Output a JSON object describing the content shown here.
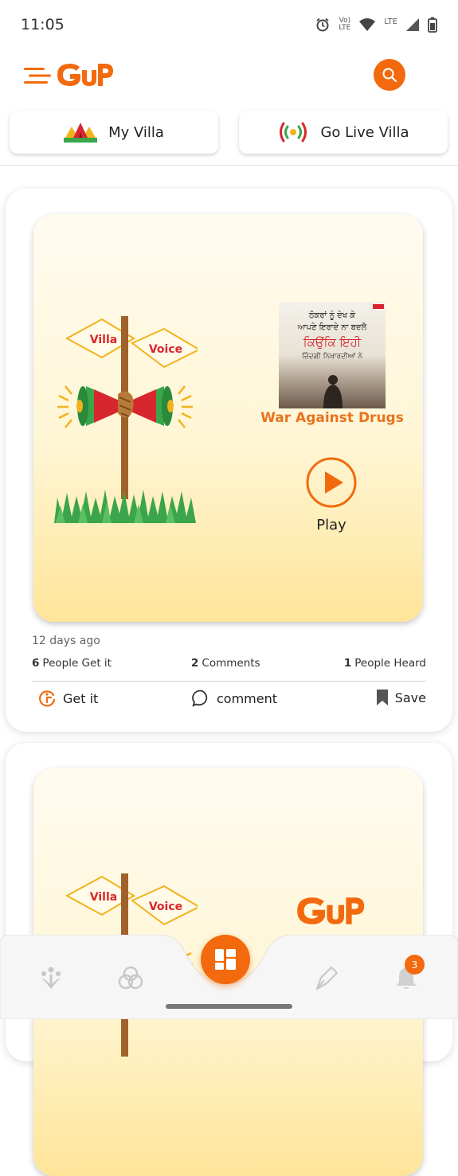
{
  "status_bar": {
    "time": "11:05",
    "lte_top": "Vo)",
    "lte_bottom": "LTE",
    "lte2": "LTE"
  },
  "header": {
    "logo_text": "GuP"
  },
  "tabs": [
    {
      "label": "My Villa",
      "icon": "villa-tents-icon"
    },
    {
      "label": "Go Live Villa",
      "icon": "live-broadcast-icon"
    }
  ],
  "posts": [
    {
      "art": {
        "sign_left": "Villa",
        "sign_right": "Voice"
      },
      "thumbnail_lines": [
        "ਠੋਕਰਾਂ ਨੂੰ ਦੇਖ ਕੇ",
        "ਆਪਣੇ ਇਰਾਦੇ ਨਾ ਬਦਲੋ",
        "ਕਿਉਂਕਿ ਇਹੀ",
        "ਜ਼ਿੰਦਗੀ ਨਿਖਾਰਦੀਆਂ ਨੇ"
      ],
      "title": "War Against Drugs",
      "play_label": "Play",
      "time_ago": "12 days ago",
      "stats": {
        "get_it_count": "6",
        "get_it_label": "People Get it",
        "comments_count": "2",
        "comments_label": "Comments",
        "heard_count": "1",
        "heard_label": "People Heard"
      },
      "actions": {
        "get_it": "Get it",
        "comment": "comment",
        "save": "Save"
      }
    },
    {
      "art": {
        "sign_left": "Villa",
        "sign_right": "Voice"
      },
      "logo_text": "GuP"
    }
  ],
  "bottom_nav": {
    "items": [
      "community-icon",
      "circles-icon",
      "grid-icon",
      "pen-nib-icon",
      "bell-icon"
    ],
    "notification_count": "3"
  },
  "colors": {
    "accent": "#f26a0d",
    "title_orange": "#e8731e"
  }
}
